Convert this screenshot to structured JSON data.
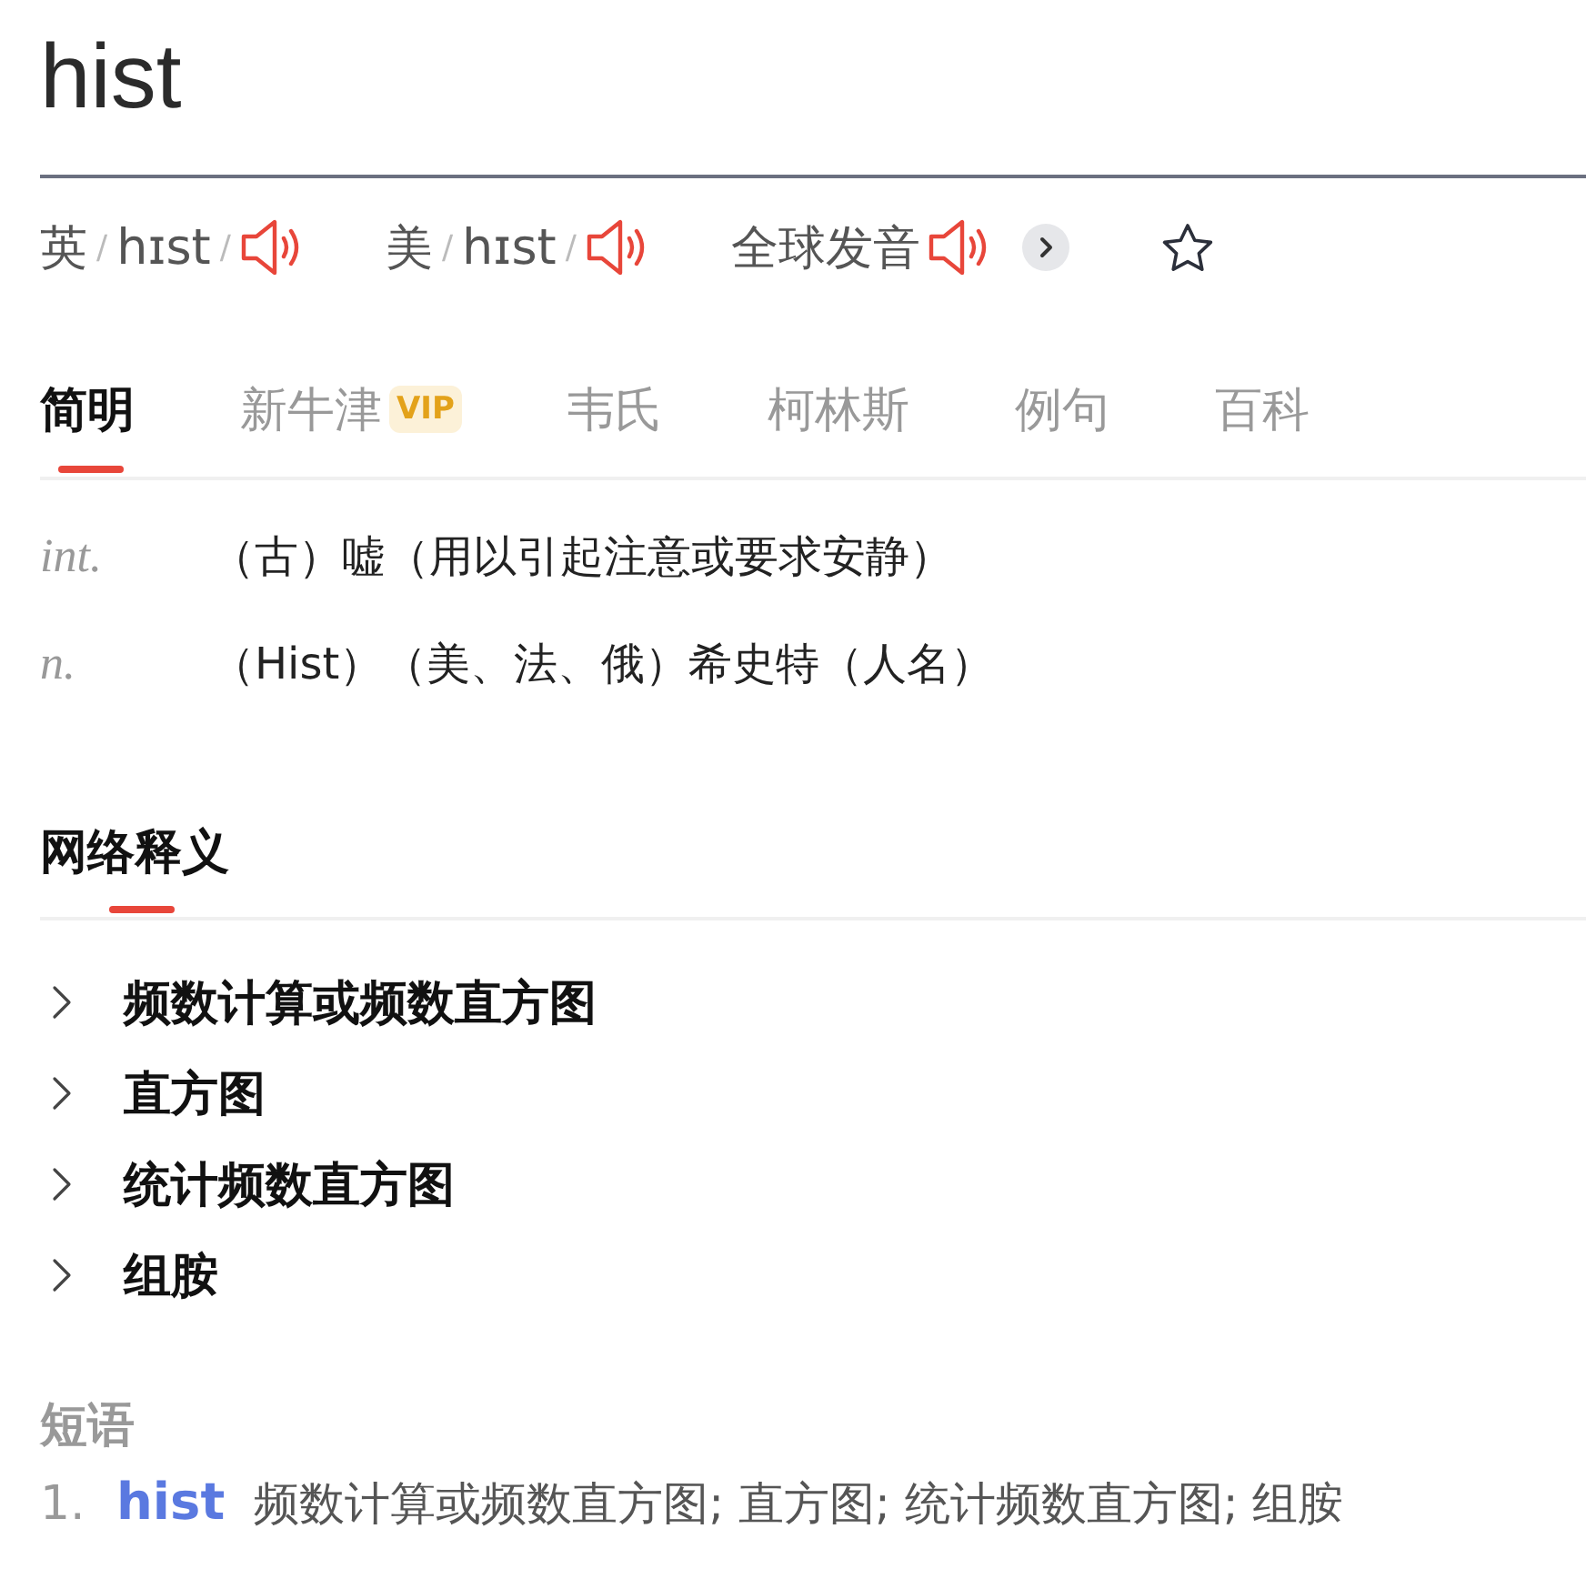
{
  "word": "hist",
  "pronunciations": [
    {
      "region": "英",
      "open": "/",
      "phonetic": "hɪst",
      "close": "/"
    },
    {
      "region": "美",
      "open": "/",
      "phonetic": "hɪst",
      "close": "/"
    }
  ],
  "global_pronunciation": {
    "label": "全球发音"
  },
  "tabs": [
    {
      "label": "简明",
      "selected": true
    },
    {
      "label": "新牛津",
      "selected": false,
      "badge": "VIP"
    },
    {
      "label": "韦氏",
      "selected": false
    },
    {
      "label": "柯林斯",
      "selected": false
    },
    {
      "label": "例句",
      "selected": false
    },
    {
      "label": "百科",
      "selected": false
    }
  ],
  "definitions": [
    {
      "pos": "int.",
      "text": "（古）嘘（用以引起注意或要求安静）"
    },
    {
      "pos": "n.",
      "text": "（Hist）（美、法、俄）希史特（人名）"
    }
  ],
  "web_section": {
    "title": "网络释义",
    "items": [
      {
        "text": "频数计算或频数直方图",
        "expanded": false
      },
      {
        "text": "直方图",
        "expanded": false
      },
      {
        "text": "统计频数直方图",
        "expanded": false
      },
      {
        "text": "组胺",
        "expanded": false
      }
    ]
  },
  "phrases_section": {
    "title": "短语",
    "phrases": [
      {
        "index": "1.",
        "word": "hist",
        "meaning": "频数计算或频数直方图; 直方图; 统计频数直方图; 组胺"
      }
    ]
  }
}
